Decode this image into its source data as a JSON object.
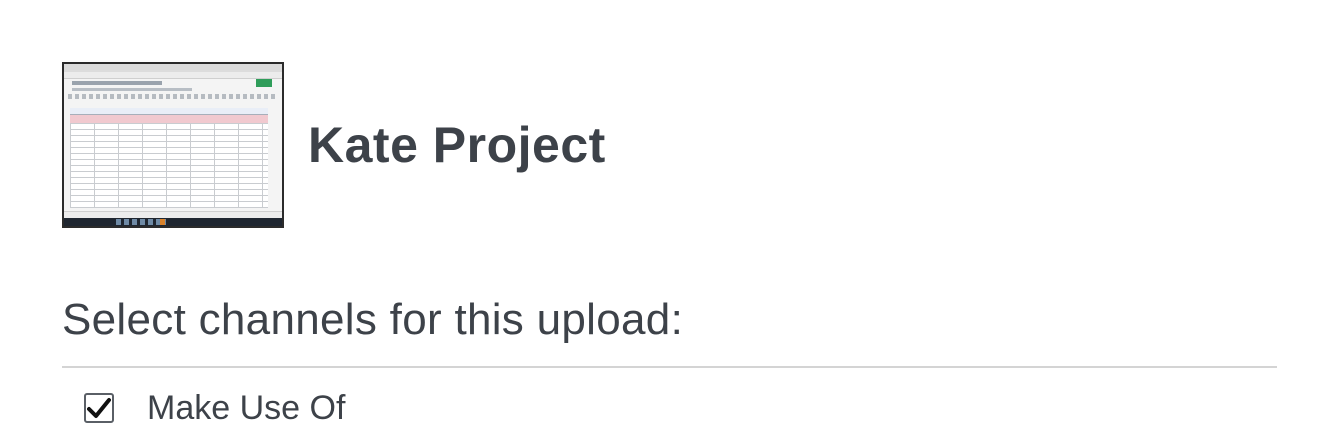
{
  "project": {
    "title": "Kate Project",
    "thumbnail_icon": "spreadsheet-screenshot-thumbnail"
  },
  "channels": {
    "heading": "Select channels for this upload:",
    "items": [
      {
        "label": "Make Use Of",
        "checked": true
      }
    ]
  }
}
